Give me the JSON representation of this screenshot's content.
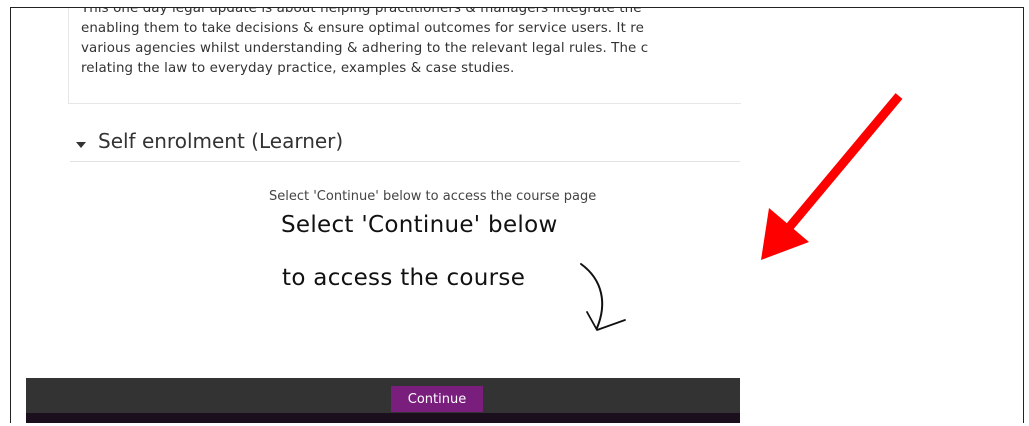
{
  "description": {
    "lines": [
      "This one day legal update is about helping practitioners & managers integrate the",
      "enabling them to take decisions & ensure optimal outcomes for service users. It re",
      "various agencies whilst understanding & adhering to the relevant legal rules. The c",
      "relating the law to everyday practice, examples & case studies."
    ]
  },
  "enrolment": {
    "section_title": "Self enrolment (Learner)",
    "caption": "Select 'Continue' below to access the course page",
    "handwritten_line1": "Select 'Continue' below",
    "handwritten_line2": "to access the course",
    "continue_label": "Continue"
  },
  "colors": {
    "continue_button": "#7a1e7e",
    "footer_bar": "#333333",
    "annotation_arrow": "#ff0000"
  },
  "icons": {
    "section_toggle": "caret-down-icon",
    "handwritten_arrow": "curved-arrow-down-icon",
    "annotation": "red-arrow-icon"
  }
}
